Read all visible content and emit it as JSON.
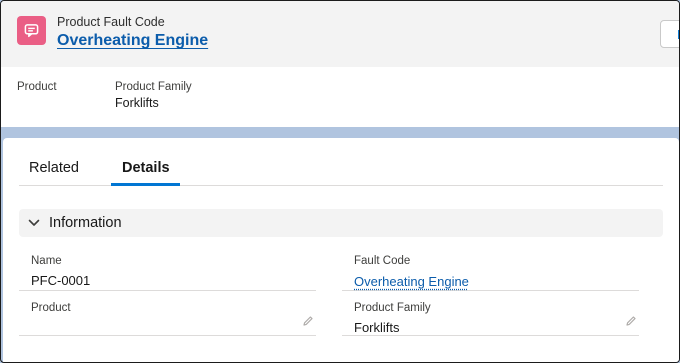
{
  "header": {
    "object_label": "Product Fault Code",
    "record_title": "Overheating Engine",
    "new_button_label": "New",
    "icon": "product-fault-icon",
    "icon_color": "#ea5e85"
  },
  "highlights": {
    "fields": [
      {
        "label": "Product",
        "value": ""
      },
      {
        "label": "Product Family",
        "value": "Forklifts"
      }
    ]
  },
  "tabs": [
    {
      "label": "Related",
      "active": false
    },
    {
      "label": "Details",
      "active": true
    }
  ],
  "section": {
    "title": "Information",
    "expanded": true
  },
  "fields": {
    "name": {
      "label": "Name",
      "value": "PFC-0001"
    },
    "fault_code": {
      "label": "Fault Code",
      "value": "Overheating Engine"
    },
    "product": {
      "label": "Product",
      "value": ""
    },
    "product_family": {
      "label": "Product Family",
      "value": "Forklifts"
    }
  },
  "colors": {
    "link": "#0b5cab",
    "active_tab": "#0176d3",
    "page_background": "#b0c4df"
  }
}
